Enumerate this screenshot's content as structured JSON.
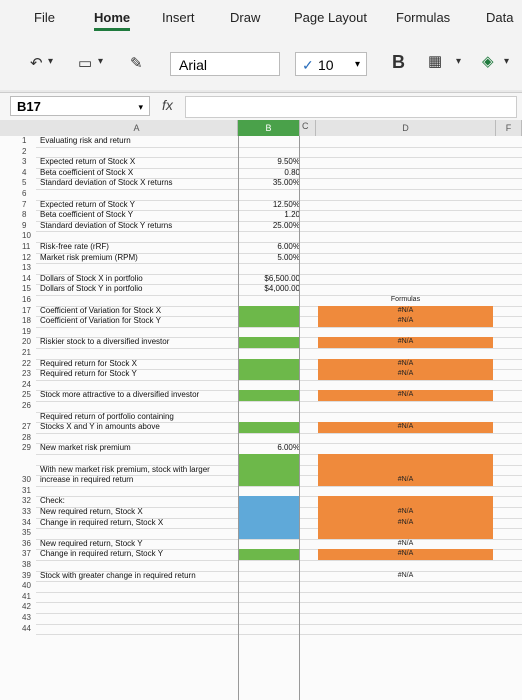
{
  "ribbon": {
    "tabs": [
      "File",
      "Home",
      "Insert",
      "Draw",
      "Page Layout",
      "Formulas",
      "Data"
    ],
    "font_name": "Arial",
    "font_size": "10",
    "bold": "B"
  },
  "formula_bar": {
    "cell_ref": "B17",
    "fx": "fx",
    "content": ""
  },
  "columns": [
    "A",
    "B",
    "C",
    "D",
    "F"
  ],
  "rows": [
    {
      "n": "1",
      "a": "Evaluating risk and return",
      "b": "",
      "d": ""
    },
    {
      "n": "2",
      "a": "",
      "b": "",
      "d": ""
    },
    {
      "n": "3",
      "a": "Expected return of Stock X",
      "b": "9.50%",
      "d": ""
    },
    {
      "n": "4",
      "a": "Beta coefficient of Stock X",
      "b": "0.80",
      "d": ""
    },
    {
      "n": "5",
      "a": "Standard deviation of Stock X returns",
      "b": "35.00%",
      "d": ""
    },
    {
      "n": "6",
      "a": "",
      "b": "",
      "d": ""
    },
    {
      "n": "7",
      "a": "Expected return of Stock Y",
      "b": "12.50%",
      "d": ""
    },
    {
      "n": "8",
      "a": "Beta coefficient of Stock Y",
      "b": "1.20",
      "d": ""
    },
    {
      "n": "9",
      "a": "Standard deviation of Stock Y returns",
      "b": "25.00%",
      "d": ""
    },
    {
      "n": "10",
      "a": "",
      "b": "",
      "d": ""
    },
    {
      "n": "11",
      "a": "Risk-free rate (rRF)",
      "b": "6.00%",
      "d": ""
    },
    {
      "n": "12",
      "a": "Market risk premium (RPM)",
      "b": "5.00%",
      "d": ""
    },
    {
      "n": "13",
      "a": "",
      "b": "",
      "d": ""
    },
    {
      "n": "14",
      "a": "Dollars of Stock X in portfolio",
      "b": "$6,500.00",
      "d": ""
    },
    {
      "n": "15",
      "a": "Dollars of Stock Y in portfolio",
      "b": "$4,000.00",
      "d": ""
    },
    {
      "n": "16",
      "a": "",
      "b": "",
      "d": "Formulas"
    },
    {
      "n": "17",
      "a": "Coefficient of Variation for Stock X",
      "b": "",
      "d": "#N/A"
    },
    {
      "n": "18",
      "a": "Coefficient of Variation for Stock Y",
      "b": "",
      "d": "#N/A"
    },
    {
      "n": "19",
      "a": "",
      "b": "",
      "d": ""
    },
    {
      "n": "20",
      "a": "Riskier stock to a diversified investor",
      "b": "",
      "d": "#N/A"
    },
    {
      "n": "21",
      "a": "",
      "b": "",
      "d": ""
    },
    {
      "n": "22",
      "a": "Required return for Stock X",
      "b": "",
      "d": "#N/A"
    },
    {
      "n": "23",
      "a": "Required return for Stock Y",
      "b": "",
      "d": "#N/A"
    },
    {
      "n": "24",
      "a": "",
      "b": "",
      "d": ""
    },
    {
      "n": "25",
      "a": "Stock more attractive to a diversified investor",
      "b": "",
      "d": "#N/A"
    },
    {
      "n": "26",
      "a": "",
      "b": "",
      "d": ""
    },
    {
      "n": "",
      "a": "Required return of portfolio containing",
      "b": "",
      "d": ""
    },
    {
      "n": "27",
      "a": "Stocks X and Y in amounts above",
      "b": "",
      "d": "#N/A"
    },
    {
      "n": "28",
      "a": "",
      "b": "",
      "d": ""
    },
    {
      "n": "29",
      "a": "New market risk premium",
      "b": "6.00%",
      "d": ""
    },
    {
      "n": "",
      "a": "",
      "b": "",
      "d": ""
    },
    {
      "n": "",
      "a": "With new market risk premium, stock with larger",
      "b": "",
      "d": ""
    },
    {
      "n": "30",
      "a": "increase in required return",
      "b": "",
      "d": "#N/A"
    },
    {
      "n": "31",
      "a": "",
      "b": "",
      "d": ""
    },
    {
      "n": "32",
      "a": "Check:",
      "b": "",
      "d": ""
    },
    {
      "n": "33",
      "a": "New required return, Stock X",
      "b": "",
      "d": "#N/A"
    },
    {
      "n": "34",
      "a": "Change in required return, Stock X",
      "b": "",
      "d": "#N/A"
    },
    {
      "n": "35",
      "a": "",
      "b": "",
      "d": ""
    },
    {
      "n": "36",
      "a": "New required return, Stock Y",
      "b": "",
      "d": "#N/A"
    },
    {
      "n": "37",
      "a": "Change in required return, Stock Y",
      "b": "",
      "d": "#N/A"
    },
    {
      "n": "38",
      "a": "",
      "b": "",
      "d": ""
    },
    {
      "n": "39",
      "a": "Stock with greater change in required return",
      "b": "",
      "d": "#N/A"
    },
    {
      "n": "40",
      "a": "",
      "b": "",
      "d": ""
    },
    {
      "n": "41",
      "a": "",
      "b": "",
      "d": ""
    },
    {
      "n": "42",
      "a": "",
      "b": "",
      "d": ""
    },
    {
      "n": "43",
      "a": "",
      "b": "",
      "d": ""
    },
    {
      "n": "44",
      "a": "",
      "b": "",
      "d": ""
    }
  ],
  "colors": {
    "green": "#6db84a",
    "orange": "#ef8a3c",
    "blue": "#5fa9d9",
    "header_b": "#4aa14a"
  }
}
